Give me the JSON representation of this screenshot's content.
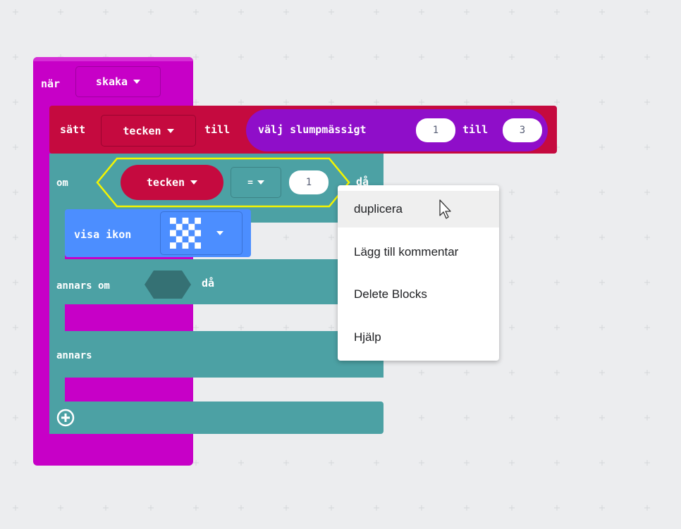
{
  "colors": {
    "background": "#ecedef",
    "grid_plus": "#d4d6da",
    "event_block": "#c700c7",
    "variables_block": "#c50a3f",
    "math_block": "#8f0ec9",
    "logic_block": "#4ca1a4",
    "basic_block": "#4c8eff",
    "highlight": "#f5f500"
  },
  "blocks": {
    "event": {
      "keyword": "när",
      "dropdown": "skaka"
    },
    "set": {
      "keyword": "sätt",
      "variable": "tecken",
      "to": "till",
      "random": {
        "label": "välj slumpmässigt",
        "from": "1",
        "to_word": "till",
        "to": "3"
      }
    },
    "if": {
      "keyword": "om",
      "condition": {
        "variable": "tecken",
        "operator": "=",
        "value": "1"
      },
      "then": "då"
    },
    "show_icon": {
      "label": "visa ikon"
    },
    "else_if": {
      "keyword": "annars om",
      "then": "då"
    },
    "else": {
      "keyword": "annars"
    }
  },
  "context_menu": {
    "items": [
      {
        "label": "duplicera"
      },
      {
        "label": "Lägg till kommentar"
      },
      {
        "label": "Delete Blocks"
      },
      {
        "label": "Hjälp"
      }
    ]
  },
  "icons": {
    "dropdown": "caret-down-icon",
    "add": "plus-circle-icon",
    "cursor": "mouse-pointer-icon",
    "show_icon_preview": "checkerboard-icon"
  }
}
